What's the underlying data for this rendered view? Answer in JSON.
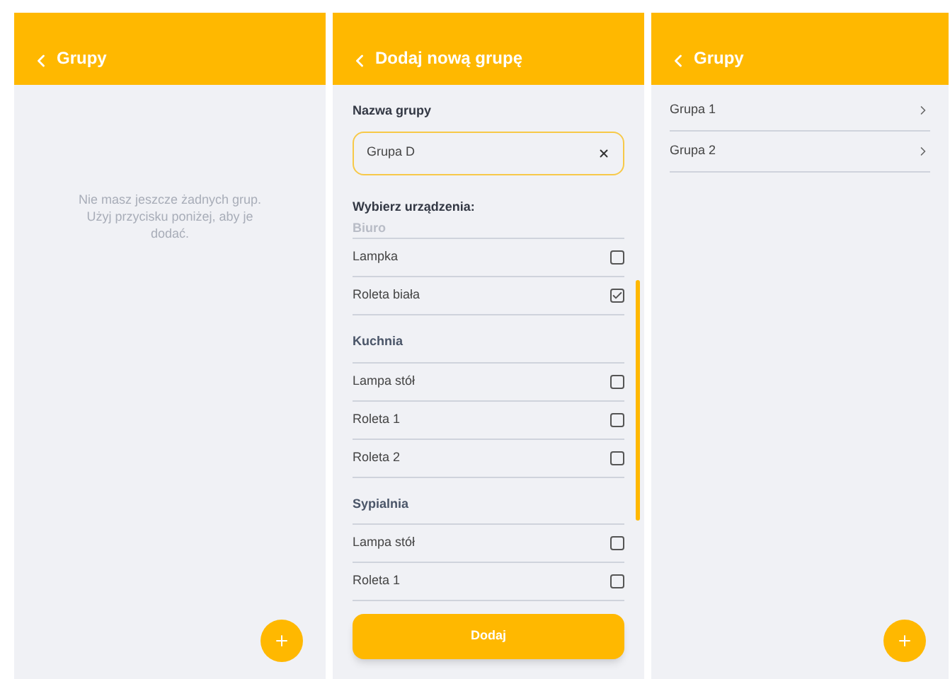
{
  "screens": [
    {
      "kind": "empty",
      "title": "Grupy",
      "message": "Nie masz jeszcze żadnych grup. Użyj przycisku poniżej, aby je dodać."
    },
    {
      "kind": "form",
      "title": "Dodaj nową grupę",
      "name_label": "Nazwa grupy",
      "name_value": "Grupa D",
      "devices_label": "Wybierz urządzenia:",
      "sections": [
        {
          "name": "Biuro",
          "devices": [
            {
              "name": "Lampka",
              "checked": false
            },
            {
              "name": "Roleta biała",
              "checked": true
            }
          ]
        },
        {
          "name": "Kuchnia",
          "devices": [
            {
              "name": "Lampa stół",
              "checked": false
            },
            {
              "name": "Roleta 1",
              "checked": false
            },
            {
              "name": "Roleta 2",
              "checked": false
            }
          ]
        },
        {
          "name": "Sypialnia",
          "devices": [
            {
              "name": "Lampa stół",
              "checked": false
            },
            {
              "name": "Roleta 1",
              "checked": false
            }
          ]
        }
      ],
      "submit": "Dodaj"
    },
    {
      "kind": "list",
      "title": "Grupy",
      "groups": [
        "Grupa 1",
        "Grupa 2"
      ]
    }
  ]
}
